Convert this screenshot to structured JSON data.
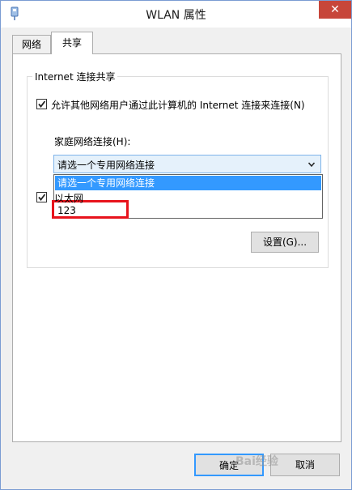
{
  "window": {
    "title": "WLAN 属性",
    "close_glyph": "✕"
  },
  "tabs": [
    {
      "label": "网络",
      "active": false
    },
    {
      "label": "共享",
      "active": true
    }
  ],
  "sharing": {
    "group_title": "Internet 连接共享",
    "allow_share_checkbox": {
      "checked": true,
      "label": "允许其他网络用户通过此计算机的 Internet 连接来连接(N)"
    },
    "home_network_label": "家庭网络连接(H):",
    "home_network_select": {
      "value": "请选一个专用网络连接",
      "options": [
        "请选一个专用网络连接",
        "以太网",
        "123"
      ],
      "selected_index": 0
    },
    "allow_control_checkbox": {
      "checked": true
    },
    "settings_button": "设置(G)..."
  },
  "footer": {
    "ok_button": "确定",
    "cancel_button": "取消"
  },
  "annotation": {
    "highlight_color": "#e8131c"
  },
  "watermark": {
    "text": "Bai经验"
  },
  "colors": {
    "selection": "#3399ff",
    "combo_focus_bg": "#e5f1fb",
    "close_button": "#c7463a"
  }
}
